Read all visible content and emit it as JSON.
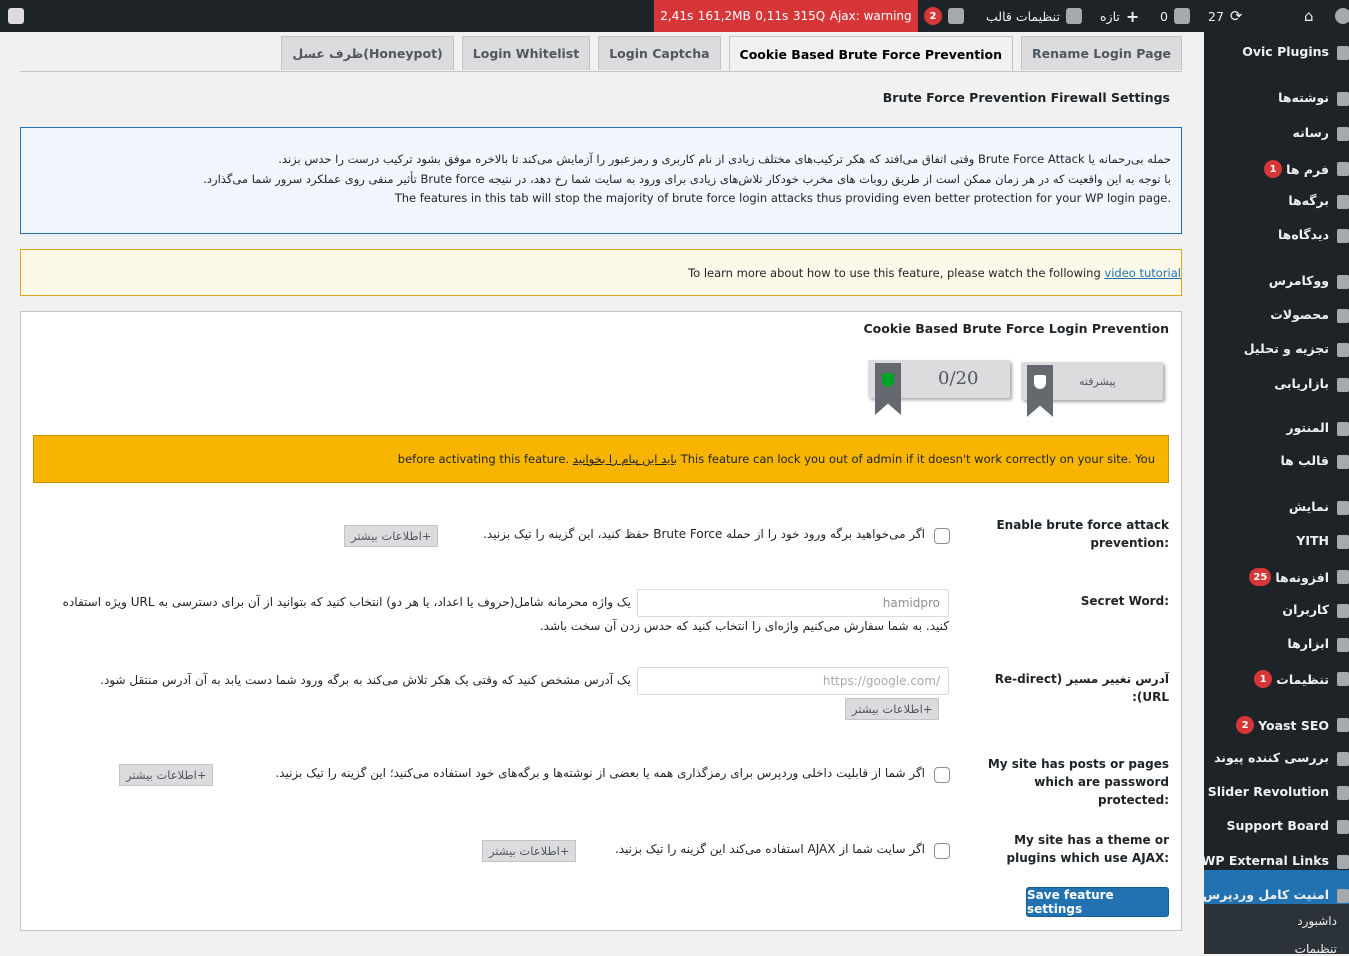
{
  "adminbar": {
    "updates_count": "27",
    "comments_count": "0",
    "new_label": "تازه",
    "theme_settings_label": "تنظیمات قالب",
    "yoast_count": "2",
    "perf": [
      "2,41s",
      "161,2MB",
      "0,11s",
      "315Q",
      "Ajax: warning"
    ]
  },
  "sidebar": {
    "items": [
      {
        "label": "Ovic Plugins",
        "badge": ""
      },
      {
        "label": "نوشته‌ها",
        "badge": ""
      },
      {
        "label": "رسانه",
        "badge": ""
      },
      {
        "label": "فرم ها",
        "badge": "1"
      },
      {
        "label": "برگه‌ها",
        "badge": ""
      },
      {
        "label": "دیدگاه‌ها",
        "badge": ""
      },
      {
        "label": "ووکامرس",
        "badge": ""
      },
      {
        "label": "محصولات",
        "badge": ""
      },
      {
        "label": "تجزیه و تحلیل",
        "badge": ""
      },
      {
        "label": "بازاریابی",
        "badge": ""
      },
      {
        "label": "المنتور",
        "badge": ""
      },
      {
        "label": "قالب ها",
        "badge": ""
      },
      {
        "label": "نمایش",
        "badge": ""
      },
      {
        "label": "YITH",
        "badge": ""
      },
      {
        "label": "افزونه‌ها",
        "badge": "25"
      },
      {
        "label": "کاربران",
        "badge": ""
      },
      {
        "label": "ابزارها",
        "badge": ""
      },
      {
        "label": "تنظیمات",
        "badge": "1"
      },
      {
        "label": "Yoast SEO",
        "badge": "2"
      },
      {
        "label": "بررسی کننده پیوند",
        "badge": ""
      },
      {
        "label": "Slider Revolution",
        "badge": ""
      },
      {
        "label": "Support Board",
        "badge": ""
      },
      {
        "label": "WP External Links",
        "badge": ""
      },
      {
        "label": "امنیت کامل وردپرس",
        "badge": ""
      }
    ],
    "submenu": [
      "داشبورد",
      "تنظیمات"
    ]
  },
  "tabs": [
    "Rename Login Page",
    "Cookie Based Brute Force Prevention",
    "Login Captcha",
    "Login Whitelist",
    "ظرف عسل(Honeypot)"
  ],
  "section_title": "Brute Force Prevention Firewall Settings",
  "info": {
    "line1": "حمله بی‌رحمانه یا Brute Force Attack وقتی اتفاق می‌افتد که هکر ترکیب‌های مختلف زیادی از نام کاربری و رمزعبور را آزمایش می‌کند تا بالاخره موفق بشود ترکیب درست را حدس بزند.",
    "line2": "با توجه به این واقعیت که در هر زمان ممکن است از طریق روبات های مخرب خودکار تلاش‌های زیادی برای ورود به سایت شما رخ دهد، در نتیجه Brute force تأثیر منفی روی عملکرد سرور شما می‌گذارد.",
    "line3": "The features in this tab will stop the majority of brute force login attacks thus providing even better protection for your WP login page."
  },
  "tutorial": {
    "text": "To learn more about how to use this feature, please watch the following",
    "link": "video tutorial"
  },
  "postbox": {
    "title": "Cookie Based Brute Force Login Prevention",
    "level_label": "پیشرفته",
    "score": "0/20",
    "warning_pre": "You",
    "warning_main": "This feature can lock you out of admin if it doesn't work correctly on your site.",
    "warning_link": "باید این پیام را بخوانید",
    "warning_post": "before activating this feature."
  },
  "rows": {
    "enable": {
      "label": "Enable brute force attack prevention:",
      "desc": "اگر می‌خواهید برگه ورود خود را از حمله Brute Force حفظ کنید، این گزینه را تیک بزنید.",
      "more": "اطلاعات بیشتر"
    },
    "secret": {
      "label": "Secret Word:",
      "value": "hamidpro",
      "desc1": "یک واژه محرمانه شامل(حروف یا اعداد، یا هر دو) انتخاب کنید که بتوانید از آن برای دسترسی به URL ویژه استفاده",
      "desc2": "کنید. به شما سفارش می‌کنیم واژه‌ای را انتخاب کنید که حدس زدن آن سخت باشد."
    },
    "redirect": {
      "label": "آدرس تغییر مسیر (Re-direct URL):",
      "placeholder": "https://google.com/",
      "desc": "یک آدرس مشخص کنید که وقتی یک هکر تلاش می‌کند به برگه ورود شما دست یابد به آن آدرس منتقل شود.",
      "more": "اطلاعات بیشتر"
    },
    "password": {
      "label": "My site has posts or pages which are password protected:",
      "desc": "اگر شما از قابلیت داخلی وردپرس برای رمزگذاری همه یا بعضی از نوشته‌ها و برگه‌های خود استفاده می‌کنید؛ این گزینه را تیک بزنید.",
      "more": "اطلاعات بیشتر"
    },
    "ajax": {
      "label": "My site has a theme or plugins which use AJAX:",
      "desc": "اگر سایت شما از AJAX استفاده می‌کند این گزینه را تیک بزنید.",
      "more": "اطلاعات بیشتر"
    }
  },
  "save_label": "Save feature settings"
}
